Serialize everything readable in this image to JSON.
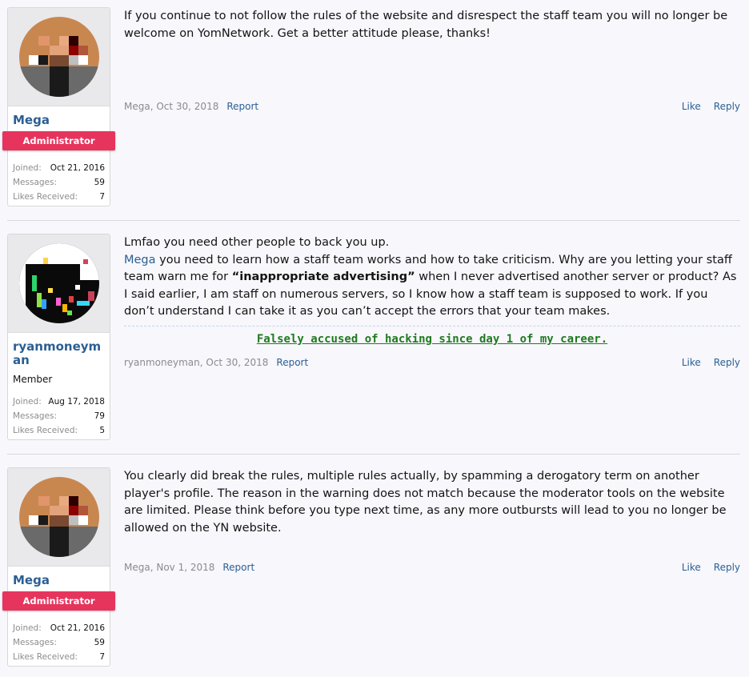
{
  "posts": [
    {
      "username": "Mega",
      "role": "Administrator",
      "joined_label": "Joined:",
      "joined": "Oct 21, 2016",
      "messages_label": "Messages:",
      "messages": "59",
      "likes_label": "Likes Received:",
      "likes": "7",
      "body": [
        "If you continue to not follow the rules of the website and disrespect the staff team you will no longer be welcome on YomNetwork. Get a better attitude please, thanks!"
      ],
      "author_date": "Mega, Oct 30, 2018",
      "report": "Report",
      "like": "Like",
      "reply": "Reply"
    },
    {
      "username": "ryanmoneyman",
      "role": "Member",
      "joined_label": "Joined:",
      "joined": "Aug 17, 2018",
      "messages_label": "Messages:",
      "messages": "79",
      "likes_label": "Likes Received:",
      "likes": "5",
      "line1": "Lmfao you need other people to back you up.",
      "mention": "Mega",
      "line2a": " you need to learn how a staff team works and how to take criticism. Why are you letting your staff team warn me for ",
      "bold": "“inappropriate advertising”",
      "line2b": " when I never advertised another server or product? As I said earlier, I am staff on numerous servers, so I know how a staff team is supposed to work. If you don’t understand I can take it as you can’t accept the errors that your team makes.",
      "signature": "Falsely accused of hacking since day 1 of my career.",
      "author_date": "ryanmoneyman, Oct 30, 2018",
      "report": "Report",
      "like": "Like",
      "reply": "Reply"
    },
    {
      "username": "Mega",
      "role": "Administrator",
      "joined_label": "Joined:",
      "joined": "Oct 21, 2016",
      "messages_label": "Messages:",
      "messages": "59",
      "likes_label": "Likes Received:",
      "likes": "7",
      "body": [
        "You clearly did break the rules, multiple rules actually, by spamming a derogatory term on another player's profile. The reason in the warning does not match because the moderator tools on the website are limited. Please think before you type next time, as any more outbursts will lead to you no longer be allowed on the YN website."
      ],
      "author_date": "Mega, Nov 1, 2018",
      "report": "Report",
      "like": "Like",
      "reply": "Reply"
    }
  ],
  "colors": {
    "accent": "#2b5f93",
    "admin_badge": "#e6345d",
    "signature": "#1f7a1f"
  }
}
